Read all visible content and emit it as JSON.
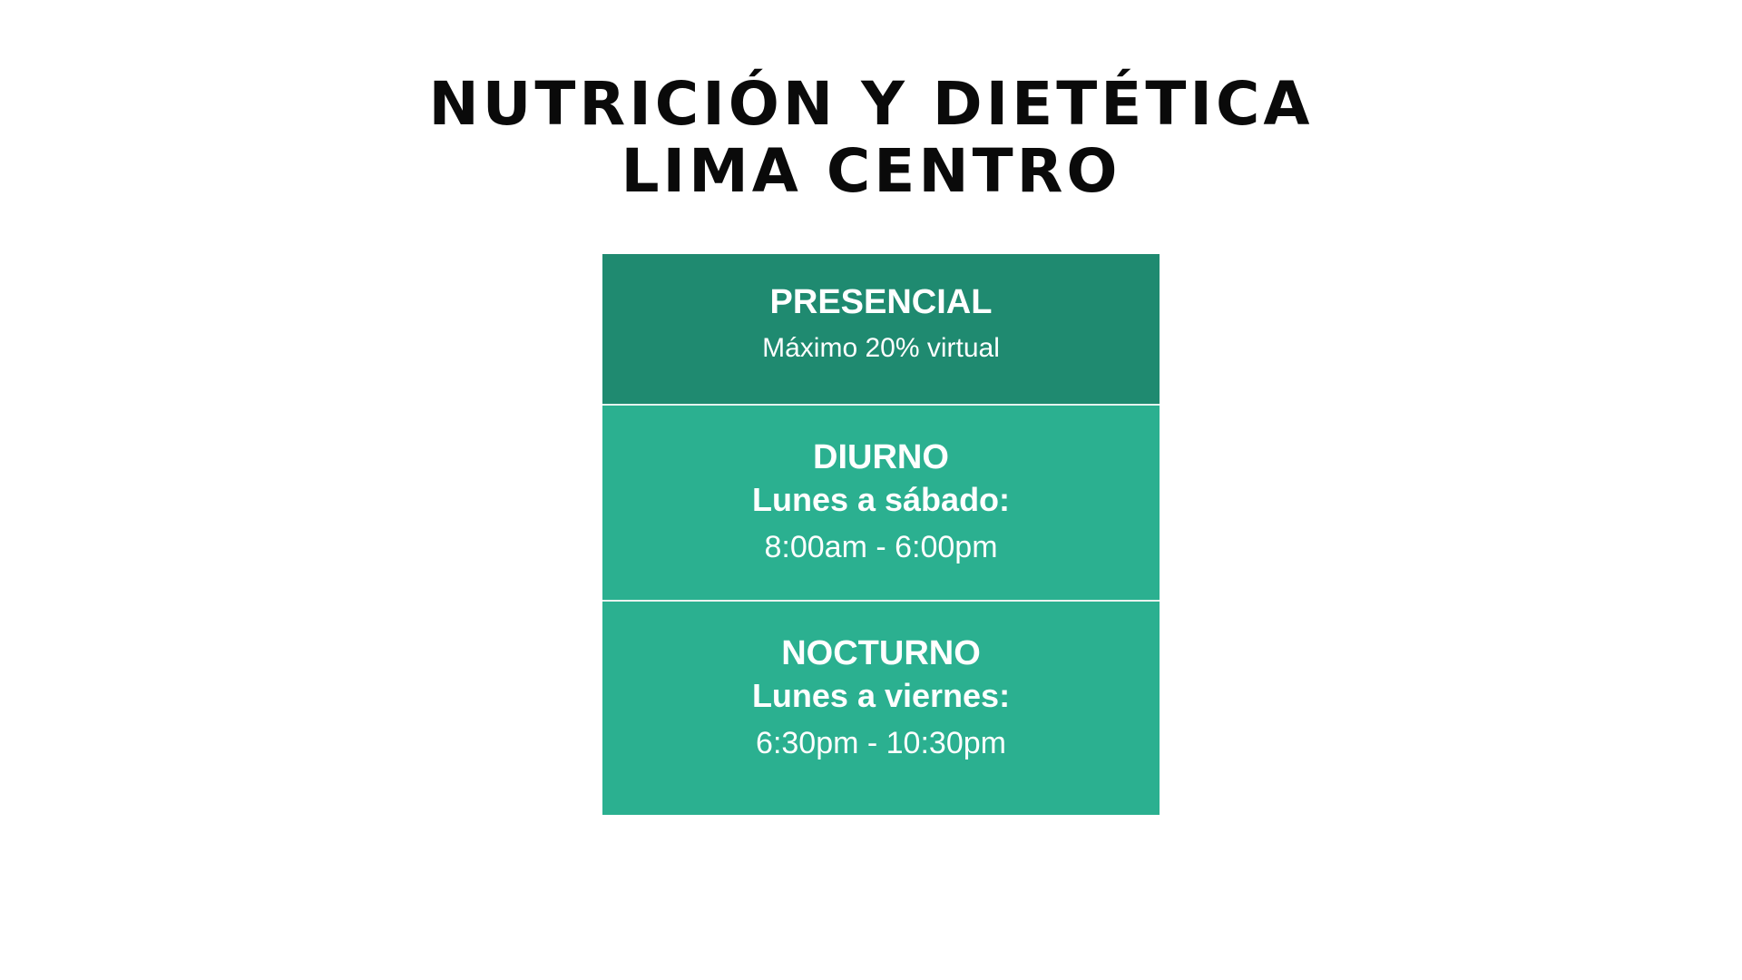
{
  "title": {
    "line1": "NUTRICIÓN Y DIETÉTICA",
    "line2": "LIMA CENTRO"
  },
  "schedule": {
    "presencial": {
      "heading": "PRESENCIAL",
      "note": "Máximo 20% virtual"
    },
    "diurno": {
      "heading": "DIURNO",
      "days": "Lunes a sábado:",
      "hours": "8:00am - 6:00pm"
    },
    "nocturno": {
      "heading": "NOCTURNO",
      "days": "Lunes a viernes:",
      "hours": "6:30pm - 10:30pm"
    }
  },
  "colors": {
    "header_cell": "#1f8a70",
    "body_cell": "#2bb090",
    "title_text": "#0a0a0a"
  }
}
